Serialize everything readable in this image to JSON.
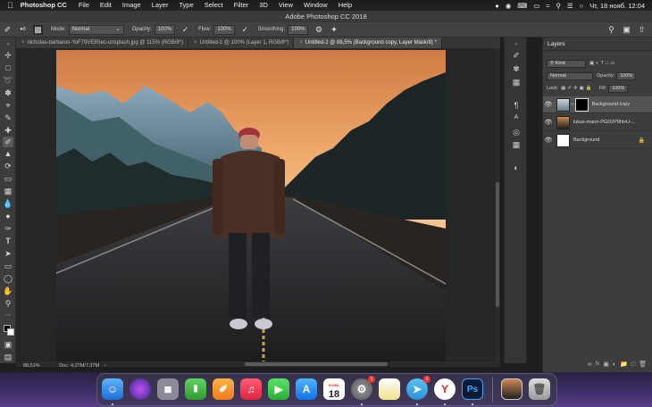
{
  "menubar": {
    "apple": "",
    "app_name": "Photoshop CC",
    "items": [
      "File",
      "Edit",
      "Image",
      "Layer",
      "Type",
      "Select",
      "Filter",
      "3D",
      "View",
      "Window",
      "Help"
    ],
    "clock": "Чт, 18 нояб.  12:04"
  },
  "window": {
    "title": "Adobe Photoshop CC 2018"
  },
  "options": {
    "brush_size": "8",
    "mode_label": "Mode:",
    "mode_value": "Normal",
    "opacity_label": "Opacity:",
    "opacity_value": "100%",
    "flow_label": "Flow:",
    "flow_value": "100%",
    "smoothing_label": "Smoothing:",
    "smoothing_value": "100%"
  },
  "tabs": [
    {
      "label": "nicholas-barbaros-YoF79VE9Sec-unsplash.jpg @ 115% (RGB/8*)"
    },
    {
      "label": "Untitled-1 @ 100% (Layer 1, RGB/8*)"
    },
    {
      "label": "Untitled-2 @ 88,5% (Background copy, Layer Mask/8) *"
    }
  ],
  "status": {
    "zoom": "88,51%",
    "doc": "Doc: 4,27M/7,37M"
  },
  "layers_panel": {
    "title": "Layers",
    "filter_kind": "Kind",
    "blend_mode": "Normal",
    "opacity_label": "Opacity:",
    "opacity_value": "100%",
    "lock_label": "Lock:",
    "fill_label": "Fill:",
    "fill_value": "100%",
    "layers": [
      {
        "name": "Background copy",
        "selected": true
      },
      {
        "name": "lukas-mann-PGD2P9hlxU-...",
        "selected": false
      },
      {
        "name": "Background",
        "selected": false
      }
    ]
  },
  "dock": {
    "calendar_month": "НОЯБ.",
    "calendar_day": "18",
    "settings_badge": "1",
    "telegram_badge": "1",
    "ps_label": "Ps"
  },
  "colors": {
    "sky_top": "#d98a4a",
    "sky_bottom": "#f2b574",
    "mountain": "#6c8fa6",
    "forest": "#1f2b2b",
    "road": "#2a2c2e",
    "cap": "#a2333a",
    "jacket": "#4a2f26"
  }
}
